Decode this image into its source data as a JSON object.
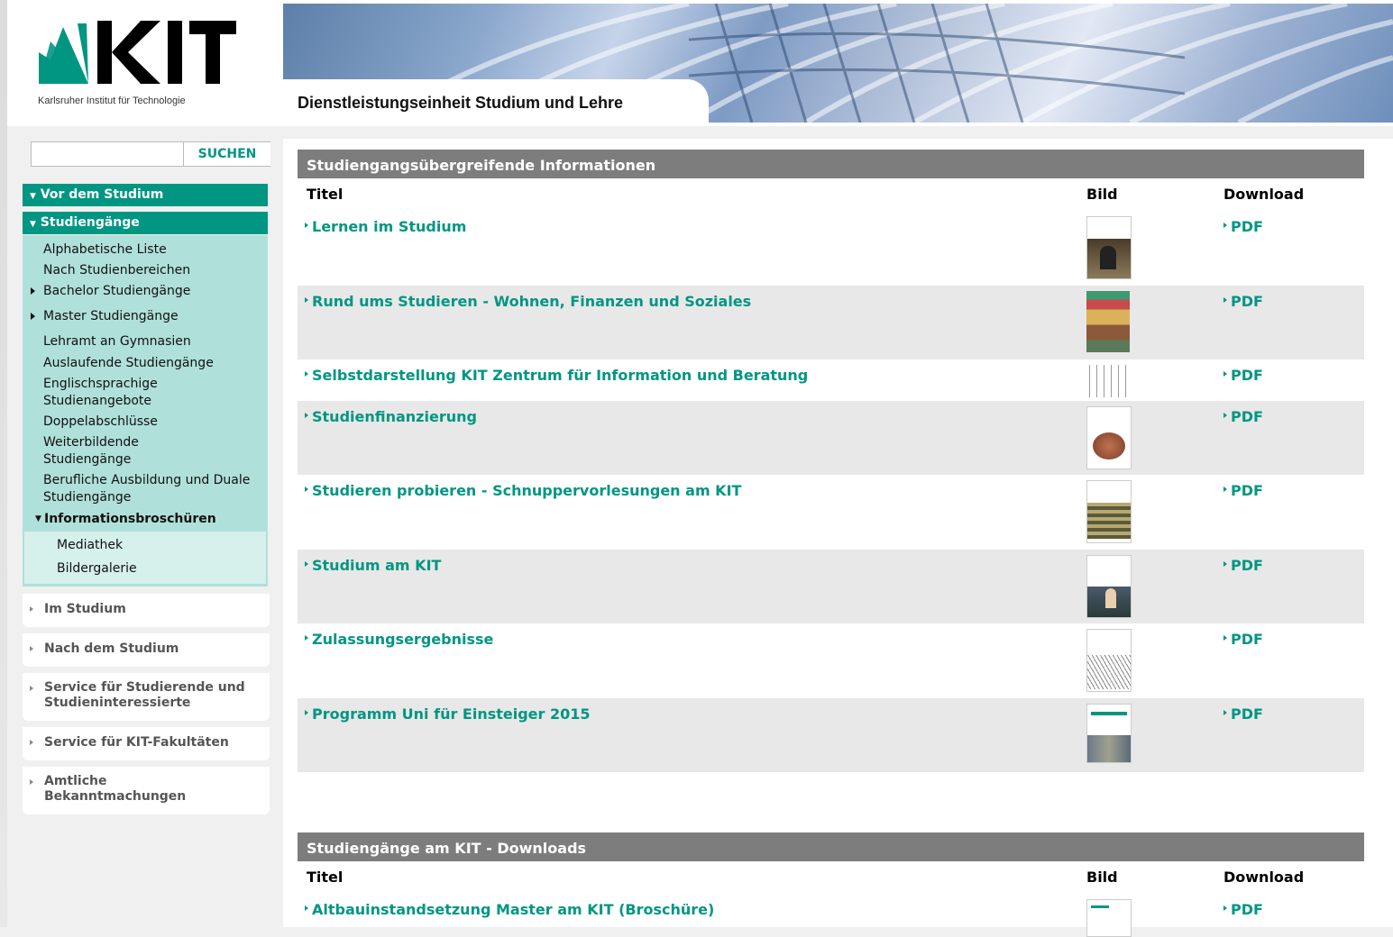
{
  "header": {
    "logo_text": "KIT",
    "logo_caption": "Karlsruher Institut für Technologie",
    "unit_title": "Dienstleistungseinheit Studium und Lehre"
  },
  "search": {
    "value": "",
    "button_label": "SUCHEN"
  },
  "sidebar": {
    "vor_dem_studium": "Vor dem Studium",
    "studiengaenge": "Studiengänge",
    "items": [
      {
        "label": "Alphabetische Liste"
      },
      {
        "label": "Nach Studienbereichen"
      },
      {
        "label": "Bachelor Studiengänge"
      },
      {
        "label": "Master Studiengänge"
      },
      {
        "label": "Lehramt an Gymnasien"
      },
      {
        "label": "Auslaufende Studiengänge"
      },
      {
        "label": "Englischsprachige Studienangebote"
      },
      {
        "label": "Doppelabschlüsse"
      },
      {
        "label": "Weiterbildende Studiengänge"
      },
      {
        "label": "Berufliche Ausbildung und Duale Studiengänge"
      }
    ],
    "informationsbroschueren": "Informationsbroschüren",
    "sub_items": [
      {
        "label": "Mediathek"
      },
      {
        "label": "Bildergalerie"
      }
    ],
    "closed_sections": [
      {
        "label": "Im Studium"
      },
      {
        "label": "Nach dem Studium"
      },
      {
        "label": "Service für Studierende und Studieninteressierte"
      },
      {
        "label": "Service für KIT-Fakultäten"
      },
      {
        "label": "Amtliche Bekanntmachungen"
      }
    ]
  },
  "section1": {
    "title": "Studiengangsübergreifende Informationen",
    "col_titel": "Titel",
    "col_bild": "Bild",
    "col_download": "Download",
    "rows": [
      {
        "title": "Lernen im Studium",
        "download": "PDF"
      },
      {
        "title": "Rund ums Studieren - Wohnen, Finanzen und Soziales",
        "download": "PDF"
      },
      {
        "title": "Selbstdarstellung KIT Zentrum für Information und Beratung",
        "download": "PDF"
      },
      {
        "title": "Studienfinanzierung",
        "download": "PDF"
      },
      {
        "title": "Studieren probieren - Schnuppervorlesungen am KIT",
        "download": "PDF"
      },
      {
        "title": "Studium am KIT",
        "download": "PDF"
      },
      {
        "title": "Zulassungsergebnisse",
        "download": "PDF"
      },
      {
        "title": "Programm Uni für Einsteiger 2015",
        "download": "PDF"
      }
    ]
  },
  "section2": {
    "title": "Studiengänge am KIT - Downloads",
    "col_titel": "Titel",
    "col_bild": "Bild",
    "col_download": "Download",
    "rows": [
      {
        "title": "Altbauinstandsetzung Master am KIT (Broschüre)",
        "download": "PDF"
      }
    ]
  },
  "colors": {
    "accent": "#009682",
    "section_header": "#7d7d7d",
    "row_alt": "#e8e8e8",
    "nav_sub_bg": "#b0e0da"
  }
}
